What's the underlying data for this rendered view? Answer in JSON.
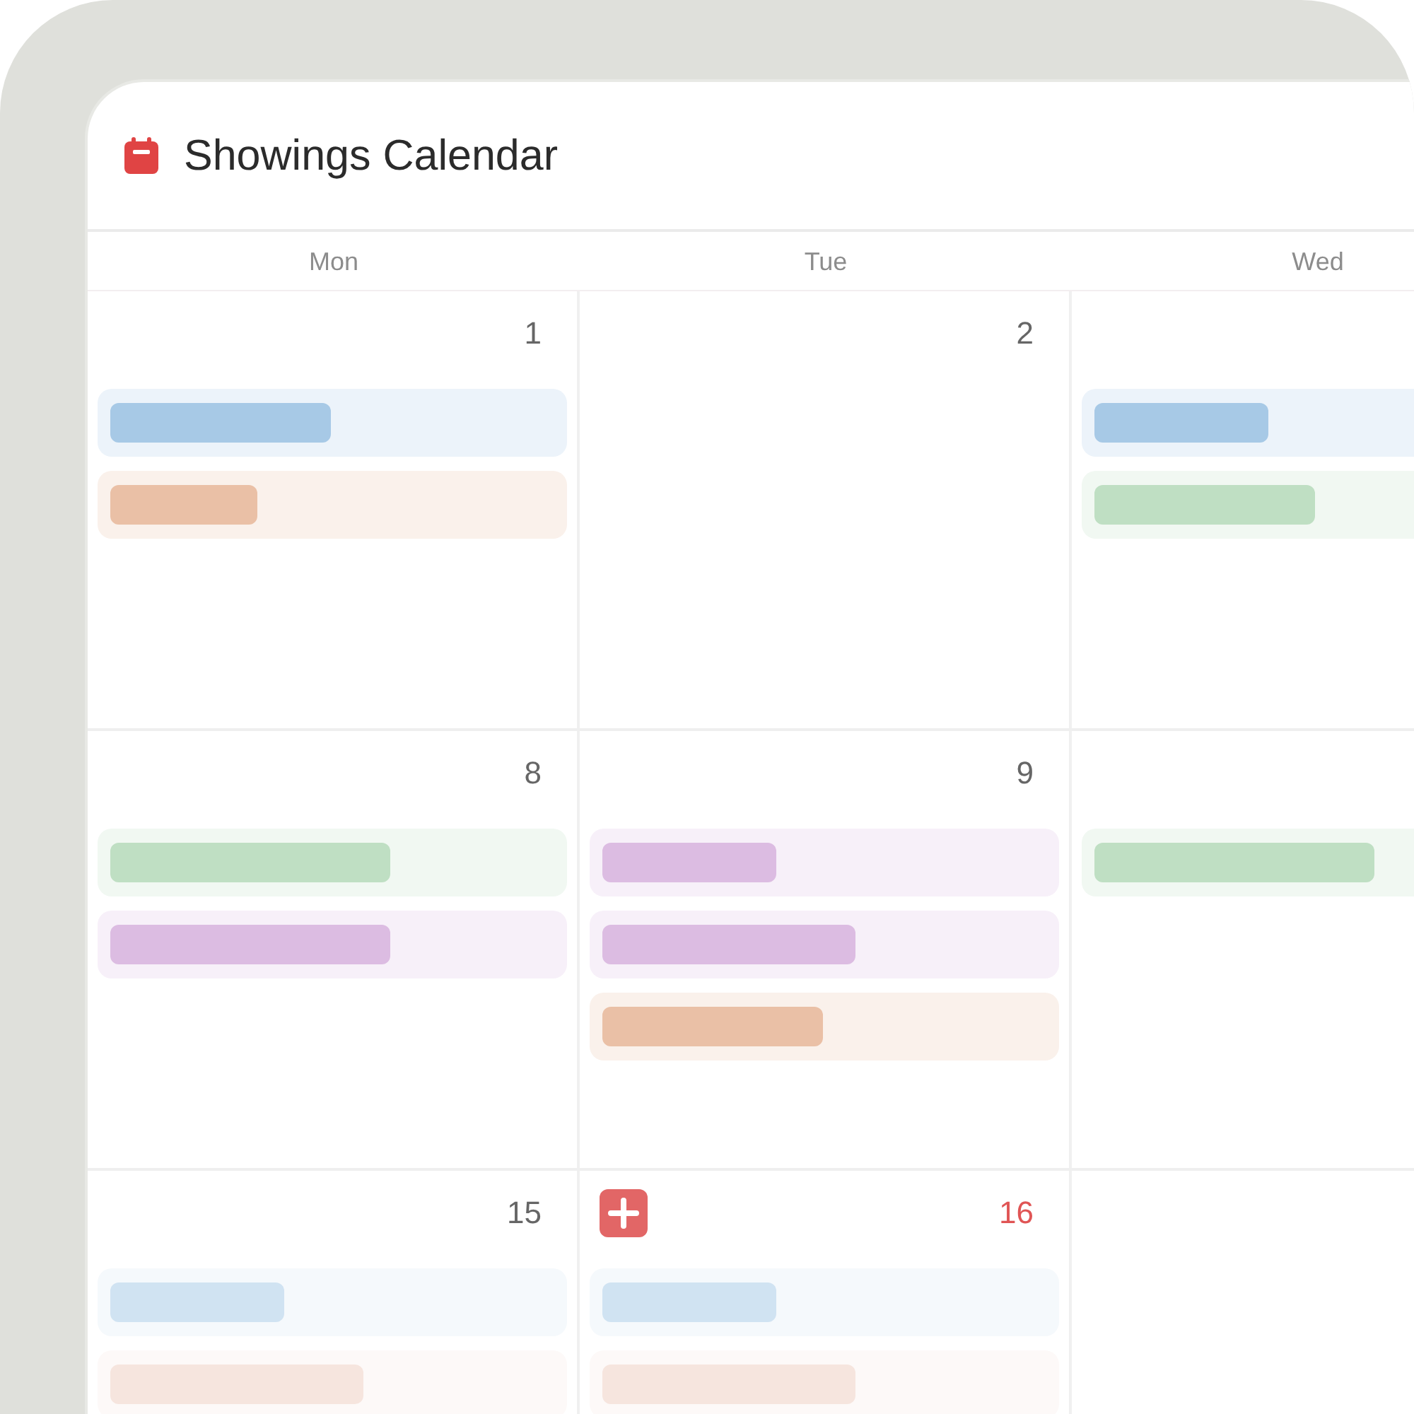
{
  "header": {
    "title": "Showings Calendar"
  },
  "weekdays": [
    "Mon",
    "Tue",
    "Wed"
  ],
  "weeks": [
    {
      "days": [
        {
          "number": "1",
          "today": false,
          "events": [
            {
              "color": "#a7c9e6",
              "kind": "medium"
            },
            {
              "color": "#eac0a6",
              "kind": "shortest"
            }
          ]
        },
        {
          "number": "2",
          "today": false
        },
        {
          "events": [
            {
              "color": "#a7c9e6",
              "kind": "short"
            },
            {
              "color": "#bfdfc3",
              "kind": "medium"
            }
          ]
        }
      ]
    },
    {
      "days": [
        {
          "number": "8",
          "today": false,
          "events": [
            {
              "color": "#bfdfc3",
              "kind": "longest"
            },
            {
              "color": "#dcbce2",
              "kind": "longest"
            }
          ]
        },
        {
          "number": "9",
          "today": false,
          "events": [
            {
              "color": "#dcbce2",
              "kind": "short"
            },
            {
              "color": "#dcbce2",
              "kind": "long"
            },
            {
              "color": "#eac0a6",
              "kind": "medium"
            }
          ]
        },
        {
          "events": [
            {
              "color": "#bfdfc3",
              "kind": "longest"
            }
          ]
        }
      ]
    },
    {
      "days": [
        {
          "number": "15",
          "today": false,
          "events": [
            {
              "color": "#d0e3f2",
              "kind": "short"
            },
            {
              "color": "#f6e5de",
              "kind": "long"
            }
          ]
        },
        {
          "number": "16",
          "today": true,
          "events": [
            {
              "color": "#d0e3f2",
              "kind": "short"
            },
            {
              "color": "#f6e5de",
              "kind": "long"
            }
          ]
        }
      ]
    }
  ]
}
